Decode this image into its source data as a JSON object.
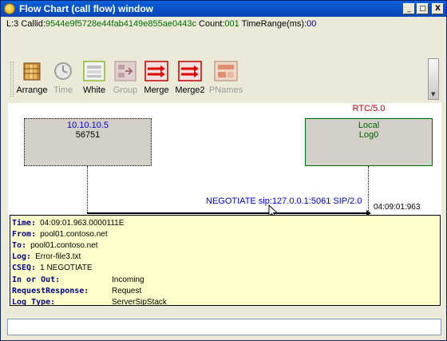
{
  "window": {
    "title": "Flow Chart (call flow) window",
    "buttons": {
      "minimize": "_",
      "maximize": "□",
      "close": "X"
    }
  },
  "infobar": {
    "level_label": "L:3 Callid:",
    "callid": "9544e9f5728e44fab4149e855ae0443c",
    "count_label": " Count:",
    "count": "001",
    "timerange_label": " TimeRange(ms):",
    "timerange": "00"
  },
  "toolbar": {
    "items": [
      {
        "label": "Arrange",
        "icon": "arrange-icon",
        "enabled": true
      },
      {
        "label": "Time",
        "icon": "clock-icon",
        "enabled": false
      },
      {
        "label": "White",
        "icon": "white-icon",
        "enabled": true
      },
      {
        "label": "Group",
        "icon": "group-icon",
        "enabled": false
      },
      {
        "label": "Merge",
        "icon": "merge-icon",
        "enabled": true
      },
      {
        "label": "Merge2",
        "icon": "merge2-icon",
        "enabled": true
      },
      {
        "label": "PNames",
        "icon": "pnames-icon",
        "enabled": false
      }
    ]
  },
  "flow": {
    "node_left": {
      "line1": "10.10.10.5",
      "line2": "56751"
    },
    "node_right": {
      "header": "RTC/5.0",
      "line1": "Local",
      "line2": "Log0"
    },
    "message": "NEGOTIATE sip:127.0.0.1:5061 SIP/2.0",
    "timestamp": "04:09:01:963"
  },
  "details": {
    "time": {
      "key": "Time:",
      "value": "04:09:01.963.0000111E"
    },
    "from": {
      "key": "From:",
      "value": "pool01.contoso.net"
    },
    "to": {
      "key": "To:",
      "value": "pool01.contoso.net"
    },
    "log": {
      "key": "Log:",
      "value": "Error-file3.txt"
    },
    "cseq": {
      "key": "CSEQ:",
      "value": "1 NEGOTIATE"
    },
    "inout": {
      "key": "In or Out:",
      "value": "Incoming"
    },
    "reqresp": {
      "key": "RequestResponse:",
      "value": "Request"
    },
    "logtype": {
      "key": "Log Type:",
      "value": "ServerSipStack"
    }
  },
  "bottom_input": {
    "value": ""
  }
}
